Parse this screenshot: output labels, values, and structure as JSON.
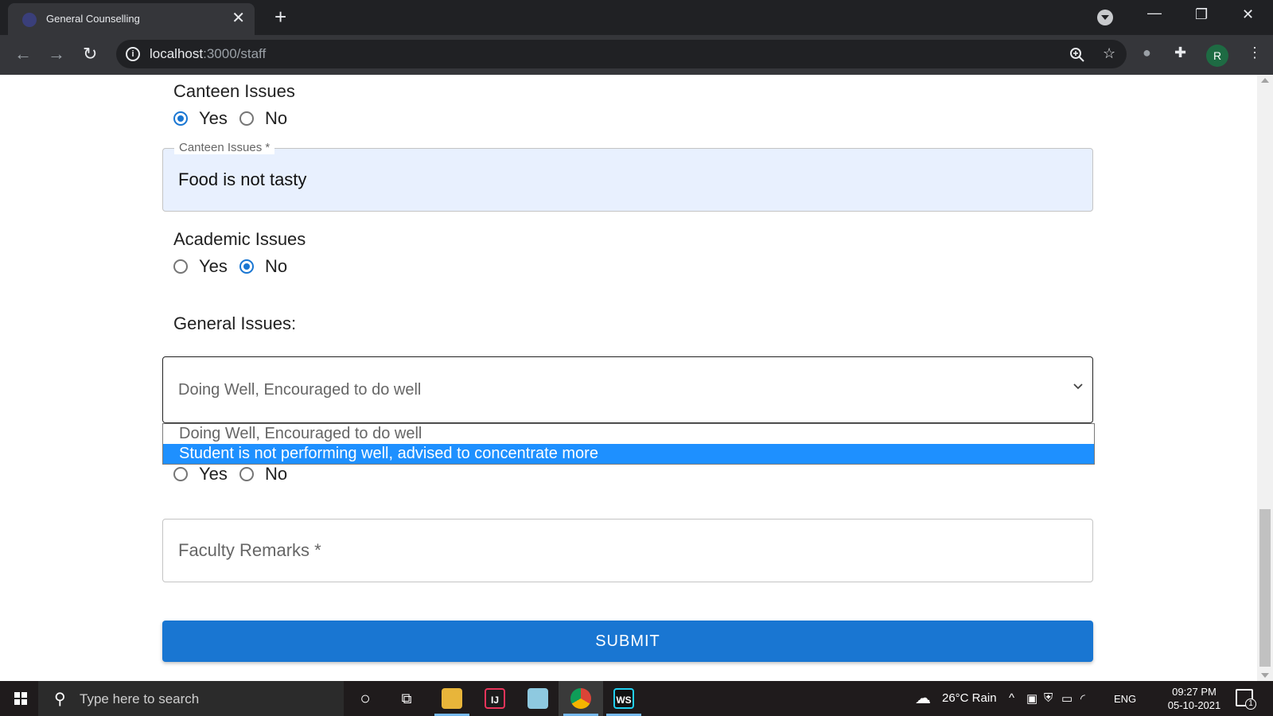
{
  "browser": {
    "tab_title": "General Counselling",
    "tab_close": "✕",
    "new_tab": "+",
    "url_host": "localhost",
    "url_path": ":3000/staff",
    "profile_initial": "R"
  },
  "form": {
    "canteen": {
      "question": "Canteen Issues",
      "yes_label": "Yes",
      "no_label": "No",
      "selected": "Yes",
      "field_label": "Canteen Issues *",
      "field_value": "Food is not tasty"
    },
    "academic": {
      "question": "Academic Issues",
      "yes_label": "Yes",
      "no_label": "No",
      "selected": "No"
    },
    "general": {
      "label": "General Issues:",
      "selected_value": "Doing Well, Encouraged to do well",
      "options": [
        "Doing Well, Encouraged to do well",
        "Student is not performing well, advised to concentrate more"
      ],
      "highlighted_option": "Student is not performing well, advised to concentrate more"
    },
    "hidden_question": {
      "yes_label": "Yes",
      "no_label": "No",
      "selected": ""
    },
    "faculty_remarks_placeholder": "Faculty Remarks *",
    "submit_label": "SUBMIT"
  },
  "taskbar": {
    "search_placeholder": "Type here to search",
    "weather": "26°C  Rain",
    "language": "ENG",
    "time": "09:27 PM",
    "date": "05-10-2021",
    "notification_count": "1",
    "apps": [
      "file-explorer",
      "intellij",
      "notepad",
      "chrome",
      "webstorm"
    ]
  },
  "colors": {
    "accent": "#1976d2",
    "option_highlight": "#1e90ff",
    "filled_field_bg": "#e8f0fe"
  }
}
